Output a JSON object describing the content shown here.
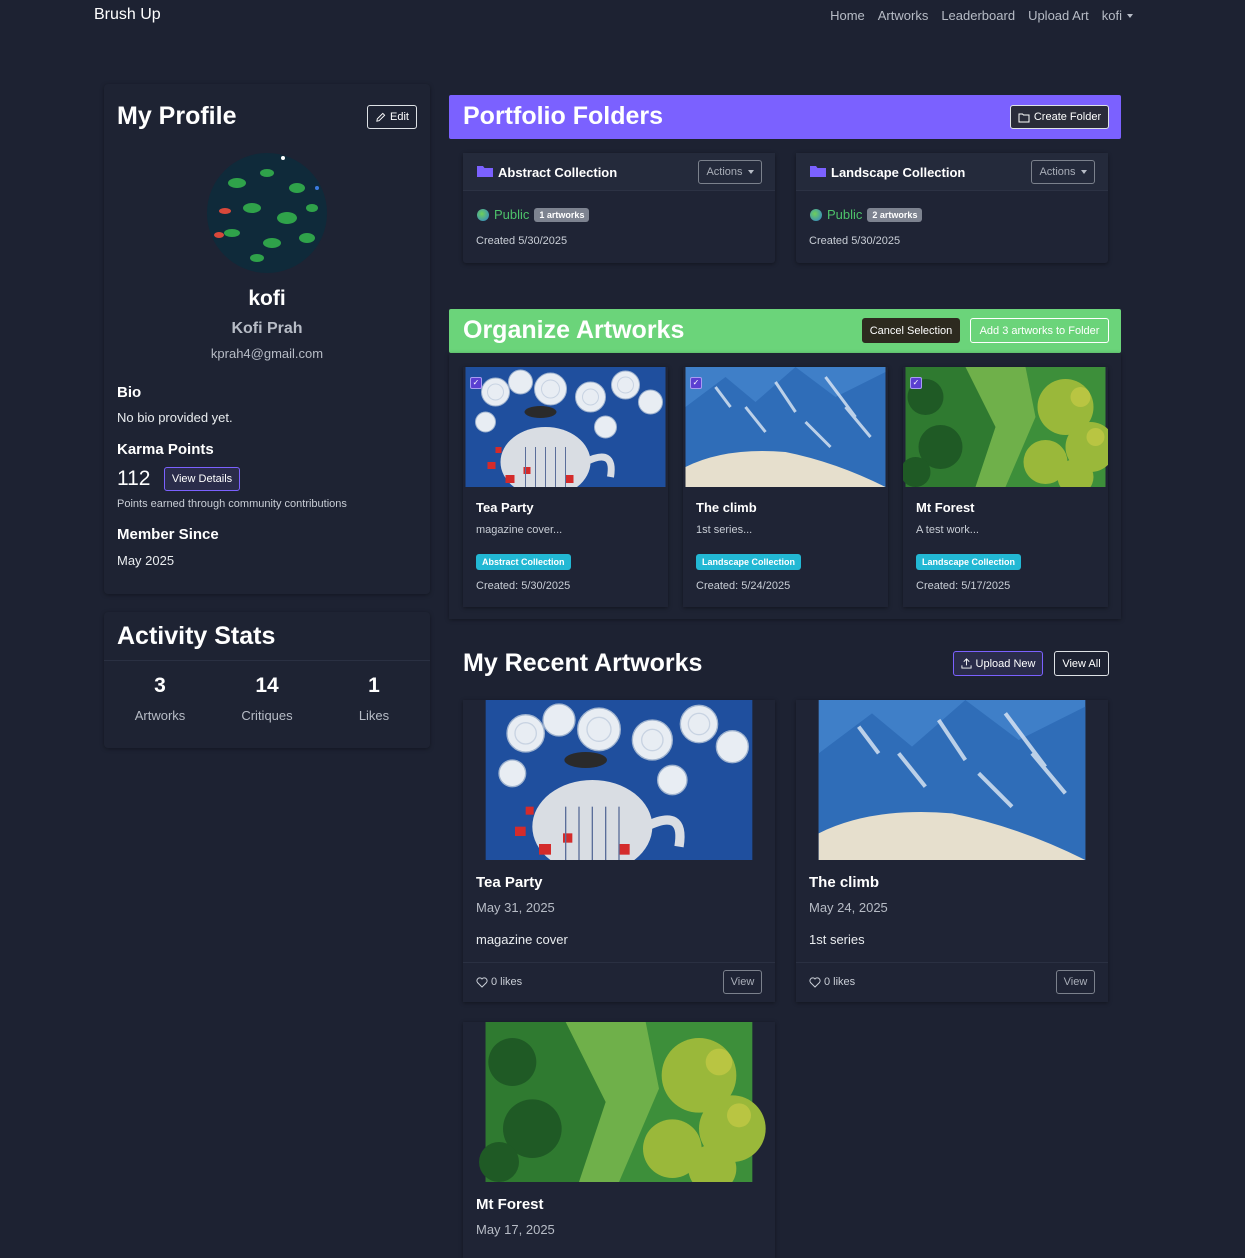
{
  "nav": {
    "brand": "Brush Up",
    "links": [
      "Home",
      "Artworks",
      "Leaderboard",
      "Upload Art"
    ],
    "user": "kofi"
  },
  "profile": {
    "title": "My Profile",
    "edit_label": "Edit",
    "username": "kofi",
    "full_name": "Kofi Prah",
    "email": "kprah4@gmail.com",
    "bio_label": "Bio",
    "bio": "No bio provided yet.",
    "karma_label": "Karma Points",
    "karma_value": "112",
    "view_details_label": "View Details",
    "karma_note": "Points earned through community contributions",
    "member_label": "Member Since",
    "member_since": "May 2025"
  },
  "activity": {
    "title": "Activity Stats",
    "stats": [
      {
        "value": "3",
        "label": "Artworks"
      },
      {
        "value": "14",
        "label": "Critiques"
      },
      {
        "value": "1",
        "label": "Likes"
      }
    ]
  },
  "folders": {
    "title": "Portfolio Folders",
    "create_label": "Create Folder",
    "accent": "#7b61ff",
    "items": [
      {
        "name": "Abstract Collection",
        "actions": "Actions",
        "visibility": "Public",
        "count": "1 artworks",
        "created": "Created 5/30/2025"
      },
      {
        "name": "Landscape Collection",
        "actions": "Actions",
        "visibility": "Public",
        "count": "2 artworks",
        "created": "Created 5/30/2025"
      }
    ]
  },
  "organize": {
    "title": "Organize Artworks",
    "cancel_label": "Cancel Selection",
    "add_label": "Add 3 artworks to Folder",
    "accent": "#6bd47a",
    "items": [
      {
        "title": "Tea Party",
        "desc": "magazine cover...",
        "folder": "Abstract Collection",
        "created": "Created: 5/30/2025"
      },
      {
        "title": "The climb",
        "desc": "1st series...",
        "folder": "Landscape Collection",
        "created": "Created: 5/24/2025"
      },
      {
        "title": "Mt Forest",
        "desc": "A test work...",
        "folder": "Landscape Collection",
        "created": "Created: 5/17/2025"
      }
    ]
  },
  "recent": {
    "title": "My Recent Artworks",
    "upload_label": "Upload New",
    "view_all_label": "View All",
    "items": [
      {
        "title": "Tea Party",
        "date": "May 31, 2025",
        "desc": "magazine cover",
        "likes": "0 likes",
        "view": "View"
      },
      {
        "title": "The climb",
        "date": "May 24, 2025",
        "desc": "1st series",
        "likes": "0 likes",
        "view": "View"
      },
      {
        "title": "Mt Forest",
        "date": "May 17, 2025"
      }
    ]
  }
}
